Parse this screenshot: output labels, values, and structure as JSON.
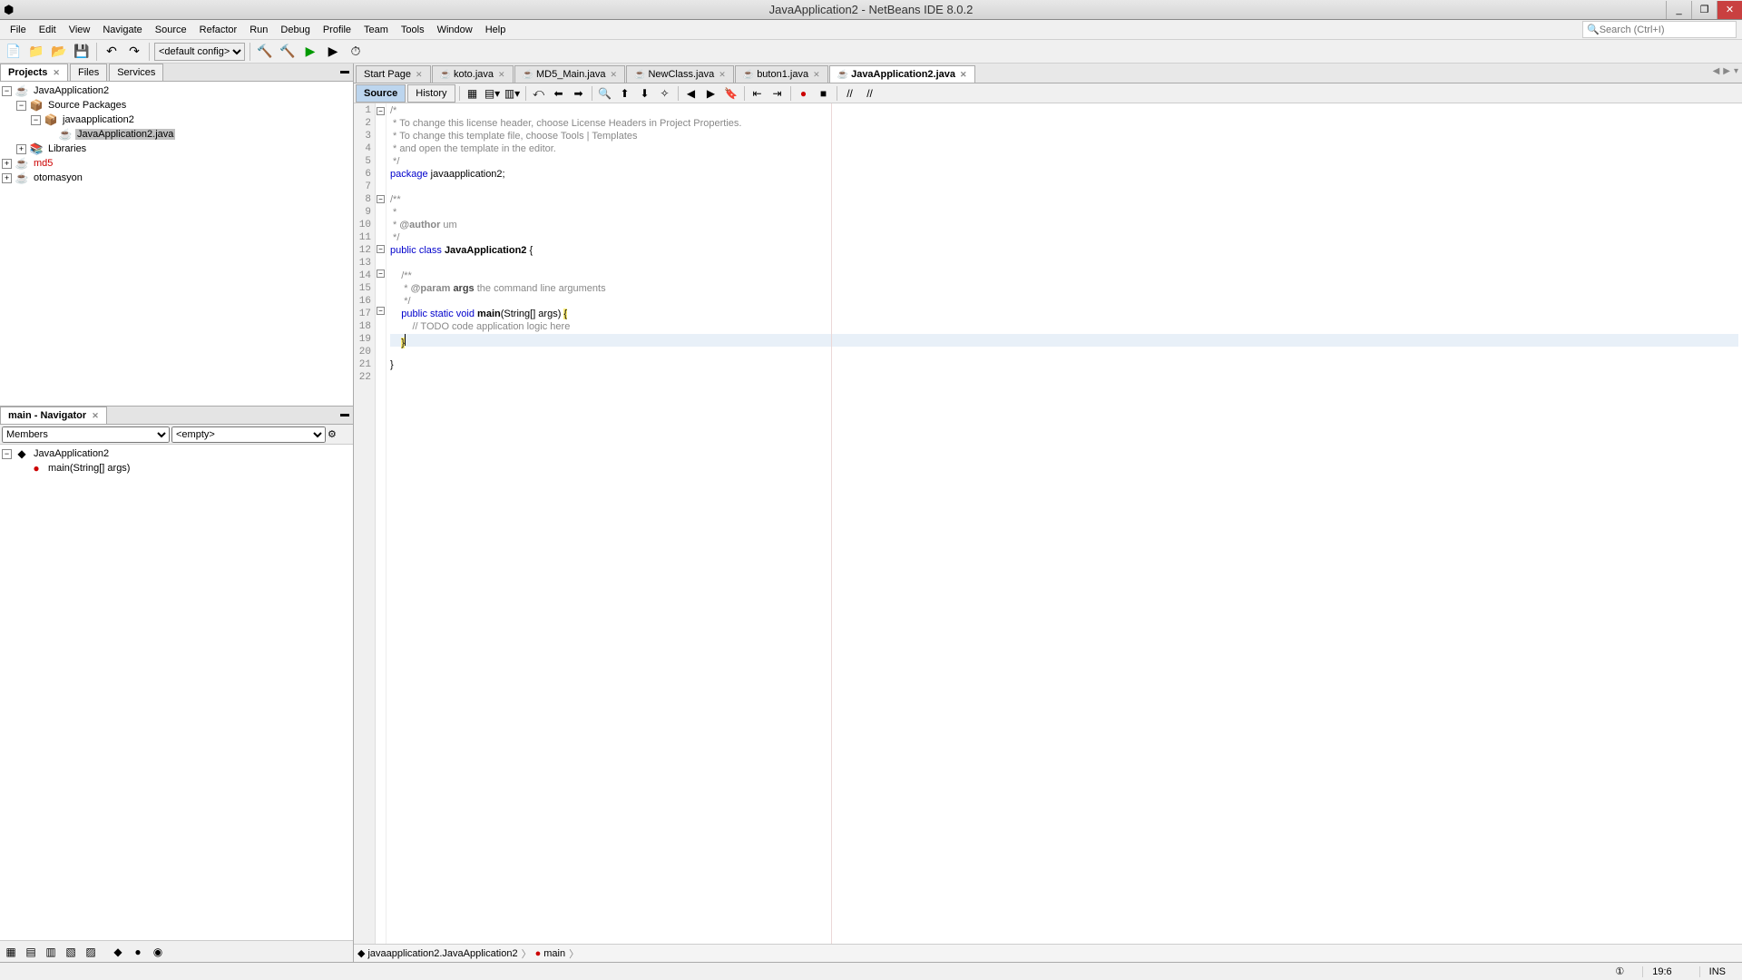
{
  "window": {
    "title": "JavaApplication2 - NetBeans IDE 8.0.2",
    "min": "_",
    "max": "❐",
    "close": "✕"
  },
  "menu": [
    "File",
    "Edit",
    "View",
    "Navigate",
    "Source",
    "Refactor",
    "Run",
    "Debug",
    "Profile",
    "Team",
    "Tools",
    "Window",
    "Help"
  ],
  "search_placeholder": "Search (Ctrl+I)",
  "config_default": "<default config>",
  "left_tabs": [
    "Projects",
    "Files",
    "Services"
  ],
  "projects_tree": {
    "root": "JavaApplication2",
    "src": "Source Packages",
    "pkg": "javaapplication2",
    "file": "JavaApplication2.java",
    "libs": "Libraries",
    "md5": "md5",
    "oto": "otomasyon"
  },
  "navigator": {
    "title": "main - Navigator",
    "view": "Members",
    "filter": "<empty>",
    "root": "JavaApplication2",
    "method": "main(String[] args)"
  },
  "editor_tabs": [
    {
      "label": "Start Page",
      "close": true,
      "icon": ""
    },
    {
      "label": "koto.java",
      "close": true,
      "icon": "☕"
    },
    {
      "label": "MD5_Main.java",
      "close": true,
      "icon": "☕"
    },
    {
      "label": "NewClass.java",
      "close": true,
      "icon": "☕"
    },
    {
      "label": "buton1.java",
      "close": true,
      "icon": "☕"
    },
    {
      "label": "JavaApplication2.java",
      "close": true,
      "icon": "☕",
      "active": true
    }
  ],
  "sub_tabs": {
    "source": "Source",
    "history": "History"
  },
  "code_lines": [
    "/*",
    " * To change this license header, choose License Headers in Project Properties.",
    " * To change this template file, choose Tools | Templates",
    " * and open the template in the editor.",
    " */",
    "package javaapplication2;",
    "",
    "/**",
    " *",
    " * @author um",
    " */",
    "public class JavaApplication2 {",
    "",
    "    /**",
    "     * @param args the command line arguments",
    "     */",
    "    public static void main(String[] args) {",
    "        // TODO code application logic here",
    "    }",
    "    ",
    "}",
    ""
  ],
  "breadcrumb": {
    "cls": "javaapplication2.JavaApplication2",
    "method": "main"
  },
  "status": {
    "pos": "19:6",
    "ins": "INS"
  }
}
